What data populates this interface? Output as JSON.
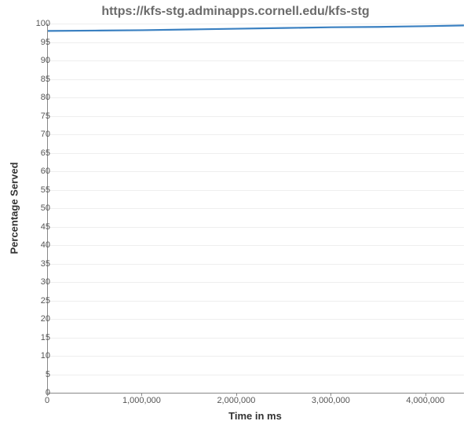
{
  "chart_data": {
    "type": "line",
    "title": "https://kfs-stg.adminapps.cornell.edu/kfs-stg",
    "xlabel": "Time in ms",
    "ylabel": "Percentage Served",
    "xlim": [
      0,
      4400000
    ],
    "ylim": [
      0,
      100
    ],
    "x_ticks": [
      0,
      1000000,
      2000000,
      3000000,
      4000000
    ],
    "x_tick_labels": [
      "0",
      "1,000,000",
      "2,000,000",
      "3,000,000",
      "4,000,000"
    ],
    "y_ticks": [
      0,
      5,
      10,
      15,
      20,
      25,
      30,
      35,
      40,
      45,
      50,
      55,
      60,
      65,
      70,
      75,
      80,
      85,
      90,
      95,
      100
    ],
    "series": [
      {
        "name": "Percentage Served",
        "color": "#3a80c1",
        "x": [
          0,
          500000,
          1000000,
          1500000,
          2000000,
          2500000,
          3000000,
          3500000,
          4000000,
          4400000
        ],
        "y": [
          98,
          98.1,
          98.2,
          98.4,
          98.6,
          98.8,
          99.0,
          99.1,
          99.3,
          99.5
        ]
      }
    ]
  }
}
